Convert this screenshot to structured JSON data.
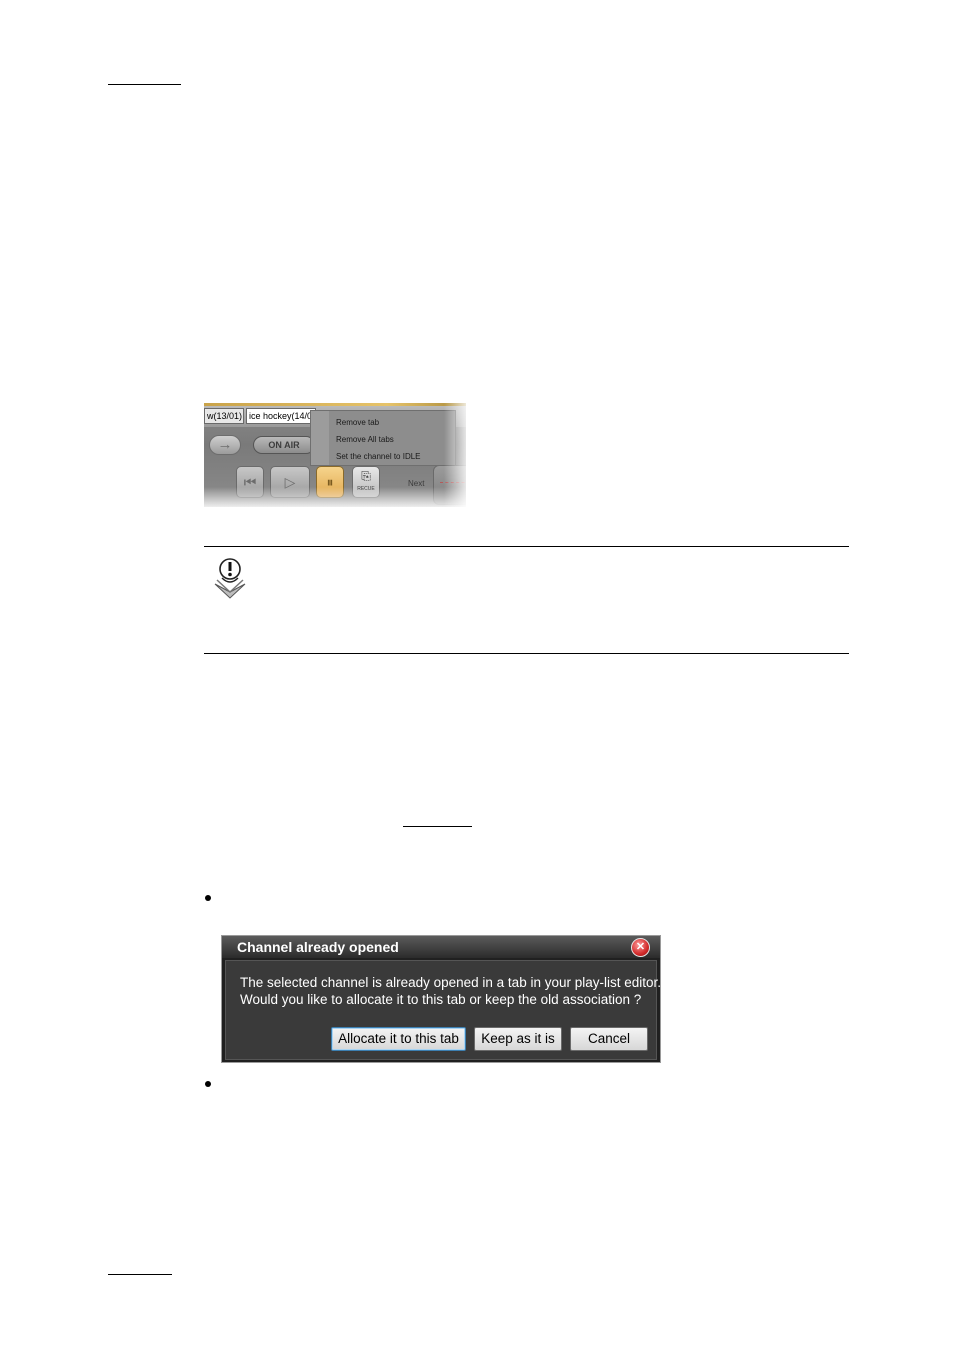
{
  "player": {
    "tabs": [
      "w(13/01)",
      "ice hockey(14/0"
    ],
    "arrow_glyph": "→",
    "on_air": "ON AIR",
    "context_menu": [
      "Remove tab",
      "Remove All tabs",
      "Set the channel to IDLE"
    ],
    "controls": {
      "prev_glyph": "⏮",
      "play_glyph": "▷",
      "pause_glyph": "⏸",
      "recue_glyph": "⎘",
      "recue_label": "RECUE"
    },
    "next_label": "Next"
  },
  "dialog": {
    "title": "Channel already opened",
    "close_glyph": "✕",
    "message_line1": "The selected channel is already opened in a tab in your play-list editor.",
    "message_line2": "Would you like to allocate it to this tab or keep the old association ?",
    "buttons": {
      "allocate": "Allocate it to this tab",
      "keep": "Keep as it is",
      "cancel": "Cancel"
    }
  }
}
